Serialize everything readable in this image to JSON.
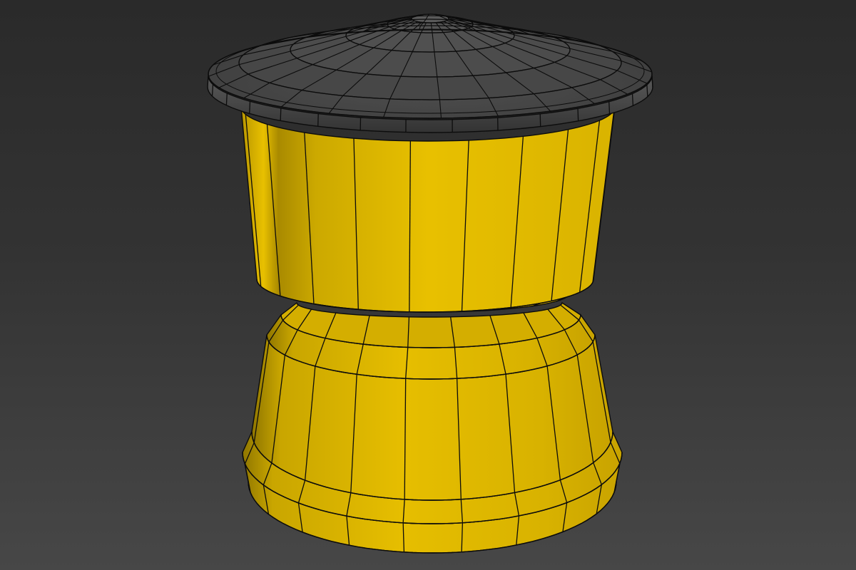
{
  "viewport": {
    "background_top": "#2a2a2a",
    "background_bottom": "#474747"
  },
  "model": {
    "name": "",
    "wire_color": "#0c0c0c",
    "cap": {
      "base_color": "#4a4a4a",
      "highlight_color": "#5e5e5e",
      "shade_color": "#2c2c2c",
      "segments": 24,
      "rings": 4
    },
    "body": {
      "base_color": "#d9b400",
      "highlight_color": "#f2cc1a",
      "shade_color": "#8f7600",
      "vertical_segments": 20
    }
  }
}
